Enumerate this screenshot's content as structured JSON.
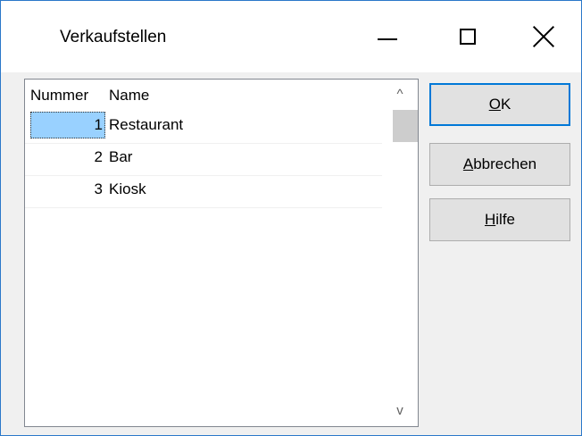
{
  "window": {
    "title": "Verkaufstellen"
  },
  "titlebar": {
    "minimize_icon": "minimize-icon",
    "maximize_icon": "maximize-icon",
    "close_icon": "close-icon"
  },
  "list": {
    "columns": [
      "Nummer",
      "Name"
    ],
    "rows": [
      {
        "nummer": "1",
        "name": "Restaurant",
        "selected": true
      },
      {
        "nummer": "2",
        "name": "Bar",
        "selected": false
      },
      {
        "nummer": "3",
        "name": "Kiosk",
        "selected": false
      }
    ],
    "scroll_up_glyph": "^",
    "scroll_down_glyph": "v"
  },
  "buttons": {
    "ok": {
      "accel": "O",
      "rest": "K"
    },
    "abbrechen": {
      "accel": "A",
      "rest": "bbrechen"
    },
    "hilfe": {
      "accel": "H",
      "rest": "ilfe"
    }
  },
  "colors": {
    "selection": "#99d1ff",
    "default_button_border": "#0078d7",
    "window_border": "#2b78c9"
  }
}
